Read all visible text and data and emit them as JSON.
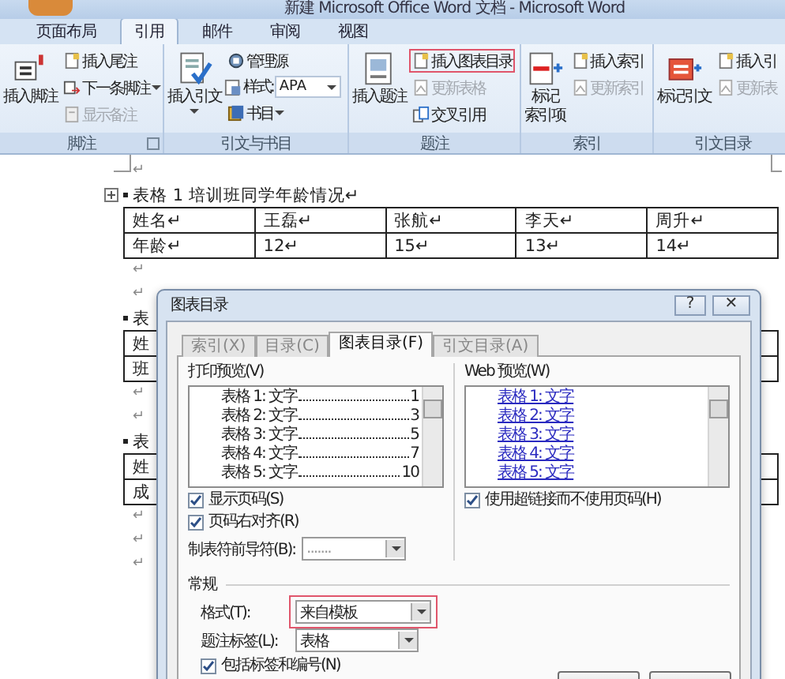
{
  "window": {
    "title": "新建 Microsoft Office Word 文档 - Microsoft Word"
  },
  "tabs": [
    {
      "label": "页面布局",
      "selected": false
    },
    {
      "label": "引用",
      "selected": true
    },
    {
      "label": "邮件",
      "selected": false
    },
    {
      "label": "审阅",
      "selected": false
    },
    {
      "label": "视图",
      "selected": false
    }
  ],
  "ribbon_groups": [
    {
      "label": "脚注",
      "launcher": true,
      "large": {
        "kind": "footnote",
        "label": "插入脚注"
      },
      "small": [
        {
          "kind": "endnote",
          "label": "插入尾注"
        },
        {
          "kind": "next",
          "label": "下一条脚注",
          "dropdown": true
        },
        {
          "kind": "notes",
          "label": "显示备注",
          "disabled": true
        }
      ]
    },
    {
      "label": "引文与书目",
      "large": {
        "kind": "citation",
        "label": "插入引文",
        "dropdown": true
      },
      "small": [
        {
          "kind": "sources",
          "label": "管理源"
        },
        {
          "kind": "style",
          "label": "样式:",
          "value": "APA"
        },
        {
          "kind": "book",
          "label": "书目",
          "dropdown": true
        }
      ]
    },
    {
      "label": "题注",
      "large": {
        "kind": "caption",
        "label": "插入题注"
      },
      "small": [
        {
          "kind": "figures",
          "label": "插入图表目录",
          "highlighted": true
        },
        {
          "kind": "update",
          "label": "更新表格",
          "disabled": true
        },
        {
          "kind": "crossref",
          "label": "交叉引用"
        }
      ]
    },
    {
      "label": "索引",
      "large": {
        "kind": "mark",
        "label": [
          "标记",
          "索引项"
        ]
      },
      "small": [
        {
          "kind": "figures",
          "label": "插入索引"
        },
        {
          "kind": "update",
          "label": "更新索引",
          "disabled": true
        }
      ]
    },
    {
      "label": "引文目录",
      "large": {
        "kind": "markcite",
        "label": "标记引文"
      },
      "small": [
        {
          "kind": "figures",
          "label": "插入引"
        },
        {
          "kind": "update",
          "label": "更新表",
          "disabled": true
        }
      ]
    }
  ],
  "document": {
    "blocks": [
      {
        "kind": "mark",
        "text": "↵"
      },
      {
        "kind": "caption",
        "text": "表格 1 培训班同学年龄情况↵",
        "handle": true
      },
      {
        "kind": "table",
        "rows": [
          [
            "姓名↵",
            "王磊↵",
            "张航↵",
            "李天↵",
            "周升↵"
          ],
          [
            "年龄↵",
            "12↵",
            "15↵",
            "13↵",
            "14↵"
          ]
        ]
      },
      {
        "kind": "mark",
        "text": "↵"
      },
      {
        "kind": "mark",
        "text": "↵"
      },
      {
        "kind": "caption",
        "text": "表"
      },
      {
        "kind": "table",
        "rows": [
          [
            "姓"
          ],
          [
            "班"
          ]
        ]
      },
      {
        "kind": "mark",
        "text": "↵"
      },
      {
        "kind": "mark",
        "text": "↵"
      },
      {
        "kind": "caption",
        "text": "表"
      },
      {
        "kind": "table",
        "rows": [
          [
            "姓"
          ],
          [
            "成"
          ]
        ]
      },
      {
        "kind": "mark",
        "text": "↵"
      },
      {
        "kind": "mark",
        "text": "↵"
      },
      {
        "kind": "mark",
        "text": "↵"
      }
    ]
  },
  "dialog": {
    "title": "图表目录",
    "help_button": "?",
    "close_button": "✕",
    "tabs": [
      {
        "label": "索引(X)",
        "selected": false
      },
      {
        "label": "目录(C)",
        "selected": false
      },
      {
        "label": "图表目录(F)",
        "selected": true
      },
      {
        "label": "引文目录(A)",
        "selected": false
      }
    ],
    "print_preview": {
      "label": "打印预览(V)",
      "entries": [
        {
          "text": "表格 1: 文字",
          "page": "1"
        },
        {
          "text": "表格 2: 文字",
          "page": "3"
        },
        {
          "text": "表格 3: 文字",
          "page": "5"
        },
        {
          "text": "表格 4: 文字",
          "page": "7"
        },
        {
          "text": "表格 5: 文字",
          "page": "10"
        }
      ]
    },
    "web_preview": {
      "label": "Web 预览(W)",
      "entries": [
        "表格 1: 文字",
        "表格 2: 文字",
        "表格 3: 文字",
        "表格 4: 文字",
        "表格 5: 文字"
      ]
    },
    "options": [
      {
        "label": "显示页码(S)",
        "checked": true
      },
      {
        "label": "页码右对齐(R)",
        "checked": true
      }
    ],
    "tab_leader": {
      "label": "制表符前导符(B):",
      "value": "......."
    },
    "web_option": {
      "label": "使用超链接而不使用页码(H)",
      "checked": true
    },
    "general": {
      "title": "常规",
      "format": {
        "label": "格式(T):",
        "value": "来自模板",
        "highlighted": true
      },
      "caption_label": {
        "label": "题注标签(L):",
        "value": "表格"
      },
      "include": {
        "label": "包括标签和编号(N)",
        "checked": true
      }
    }
  }
}
